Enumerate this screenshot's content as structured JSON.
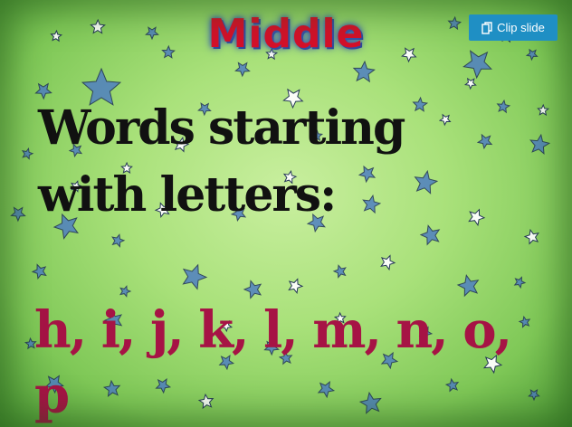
{
  "slide": {
    "title": "Middle",
    "heading": "Words starting with letters:",
    "letters": "h, i, j, k, l, m, n, o, p"
  },
  "toolbar": {
    "clip_label": "Clip slide",
    "clip_icon": "clip-icon"
  },
  "colors": {
    "title": "#d4102a",
    "letters": "#a61345",
    "button": "#1f8fc4"
  }
}
